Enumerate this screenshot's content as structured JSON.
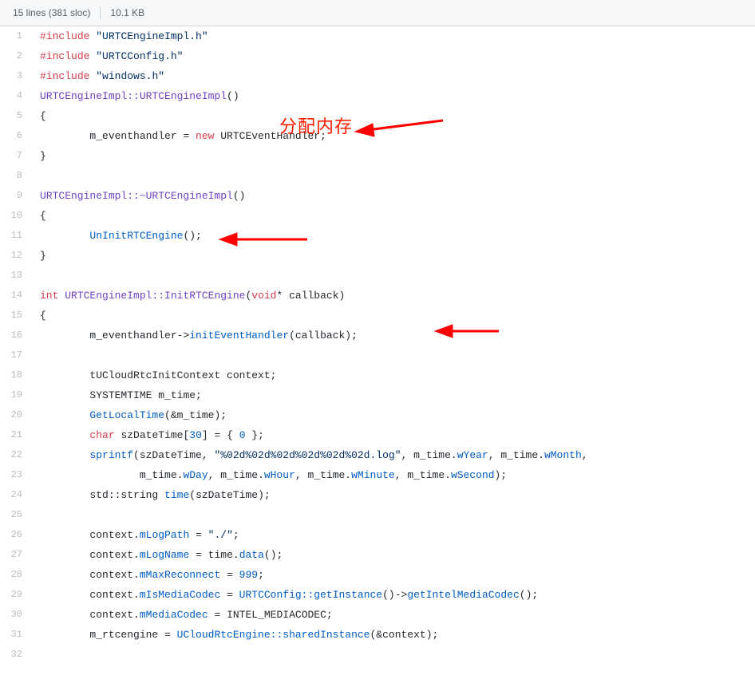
{
  "header": {
    "lines_label": "15 lines (381 sloc)",
    "size_label": "10.1 KB"
  },
  "annotations": {
    "alloc_text": "分配内存"
  },
  "code": [
    {
      "n": 1,
      "tokens": [
        {
          "t": "#",
          "c": "pl-k"
        },
        {
          "t": "include",
          "c": "pl-k"
        },
        {
          "t": " "
        },
        {
          "t": "\"URTCEngineImpl.h\"",
          "c": "pl-s"
        }
      ]
    },
    {
      "n": 2,
      "tokens": [
        {
          "t": "#",
          "c": "pl-k"
        },
        {
          "t": "include",
          "c": "pl-k"
        },
        {
          "t": " "
        },
        {
          "t": "\"URTCConfig.h\"",
          "c": "pl-s"
        }
      ]
    },
    {
      "n": 3,
      "tokens": [
        {
          "t": "#",
          "c": "pl-k"
        },
        {
          "t": "include",
          "c": "pl-k"
        },
        {
          "t": " "
        },
        {
          "t": "\"windows.h\"",
          "c": "pl-s"
        }
      ]
    },
    {
      "n": 4,
      "tokens": [
        {
          "t": "URTCEngineImpl::URTCEngineImpl",
          "c": "pl-en"
        },
        {
          "t": "()"
        }
      ]
    },
    {
      "n": 5,
      "tokens": [
        {
          "t": "{"
        }
      ]
    },
    {
      "n": 6,
      "tokens": [
        {
          "t": "\tm_eventhandler = "
        },
        {
          "t": "new",
          "c": "pl-k"
        },
        {
          "t": " URTCEventHandler;"
        }
      ]
    },
    {
      "n": 7,
      "tokens": [
        {
          "t": "}"
        }
      ]
    },
    {
      "n": 8,
      "tokens": []
    },
    {
      "n": 9,
      "tokens": [
        {
          "t": "URTCEngineImpl::~URTCEngineImpl",
          "c": "pl-en"
        },
        {
          "t": "()"
        }
      ]
    },
    {
      "n": 10,
      "tokens": [
        {
          "t": "{"
        }
      ]
    },
    {
      "n": 11,
      "tokens": [
        {
          "t": "\t"
        },
        {
          "t": "UnInitRTCEngine",
          "c": "pl-c1"
        },
        {
          "t": "();"
        }
      ]
    },
    {
      "n": 12,
      "tokens": [
        {
          "t": "}"
        }
      ]
    },
    {
      "n": 13,
      "tokens": []
    },
    {
      "n": 14,
      "tokens": [
        {
          "t": "int",
          "c": "pl-k"
        },
        {
          "t": " "
        },
        {
          "t": "URTCEngineImpl::InitRTCEngine",
          "c": "pl-en"
        },
        {
          "t": "("
        },
        {
          "t": "void",
          "c": "pl-k"
        },
        {
          "t": "* callback)"
        }
      ]
    },
    {
      "n": 15,
      "tokens": [
        {
          "t": "{"
        }
      ]
    },
    {
      "n": 16,
      "tokens": [
        {
          "t": "\tm_eventhandler->"
        },
        {
          "t": "initEventHandler",
          "c": "pl-c1"
        },
        {
          "t": "(callback);"
        }
      ]
    },
    {
      "n": 17,
      "tokens": []
    },
    {
      "n": 18,
      "tokens": [
        {
          "t": "\ttUCloudRtcInitContext context;"
        }
      ]
    },
    {
      "n": 19,
      "tokens": [
        {
          "t": "\tSYSTEMTIME m_time;"
        }
      ]
    },
    {
      "n": 20,
      "tokens": [
        {
          "t": "\t"
        },
        {
          "t": "GetLocalTime",
          "c": "pl-c1"
        },
        {
          "t": "(&m_time);"
        }
      ]
    },
    {
      "n": 21,
      "tokens": [
        {
          "t": "\t"
        },
        {
          "t": "char",
          "c": "pl-k"
        },
        {
          "t": " szDateTime["
        },
        {
          "t": "30",
          "c": "pl-c1"
        },
        {
          "t": "] = { "
        },
        {
          "t": "0",
          "c": "pl-c1"
        },
        {
          "t": " };"
        }
      ]
    },
    {
      "n": 22,
      "tokens": [
        {
          "t": "\t"
        },
        {
          "t": "sprintf",
          "c": "pl-c1"
        },
        {
          "t": "(szDateTime, "
        },
        {
          "t": "\"%02d%02d%02d%02d%02d%02d.log\"",
          "c": "pl-s"
        },
        {
          "t": ", m_time."
        },
        {
          "t": "wYear",
          "c": "pl-c1"
        },
        {
          "t": ", m_time."
        },
        {
          "t": "wMonth",
          "c": "pl-c1"
        },
        {
          "t": ","
        }
      ]
    },
    {
      "n": 23,
      "tokens": [
        {
          "t": "\t\tm_time."
        },
        {
          "t": "wDay",
          "c": "pl-c1"
        },
        {
          "t": ", m_time."
        },
        {
          "t": "wHour",
          "c": "pl-c1"
        },
        {
          "t": ", m_time."
        },
        {
          "t": "wMinute",
          "c": "pl-c1"
        },
        {
          "t": ", m_time."
        },
        {
          "t": "wSecond",
          "c": "pl-c1"
        },
        {
          "t": ");"
        }
      ]
    },
    {
      "n": 24,
      "tokens": [
        {
          "t": "\tstd::string "
        },
        {
          "t": "time",
          "c": "pl-c1"
        },
        {
          "t": "(szDateTime);"
        }
      ]
    },
    {
      "n": 25,
      "tokens": []
    },
    {
      "n": 26,
      "tokens": [
        {
          "t": "\tcontext."
        },
        {
          "t": "mLogPath",
          "c": "pl-c1"
        },
        {
          "t": " = "
        },
        {
          "t": "\"./\"",
          "c": "pl-s"
        },
        {
          "t": ";"
        }
      ]
    },
    {
      "n": 27,
      "tokens": [
        {
          "t": "\tcontext."
        },
        {
          "t": "mLogName",
          "c": "pl-c1"
        },
        {
          "t": " = time."
        },
        {
          "t": "data",
          "c": "pl-c1"
        },
        {
          "t": "();"
        }
      ]
    },
    {
      "n": 28,
      "tokens": [
        {
          "t": "\tcontext."
        },
        {
          "t": "mMaxReconnect",
          "c": "pl-c1"
        },
        {
          "t": " = "
        },
        {
          "t": "999",
          "c": "pl-c1"
        },
        {
          "t": ";"
        }
      ]
    },
    {
      "n": 29,
      "tokens": [
        {
          "t": "\tcontext."
        },
        {
          "t": "mIsMediaCodec",
          "c": "pl-c1"
        },
        {
          "t": " = "
        },
        {
          "t": "URTCConfig::getInstance",
          "c": "pl-c1"
        },
        {
          "t": "()->"
        },
        {
          "t": "getIntelMediaCodec",
          "c": "pl-c1"
        },
        {
          "t": "();"
        }
      ]
    },
    {
      "n": 30,
      "tokens": [
        {
          "t": "\tcontext."
        },
        {
          "t": "mMediaCodec",
          "c": "pl-c1"
        },
        {
          "t": " = INTEL_MEDIACODEC;"
        }
      ]
    },
    {
      "n": 31,
      "tokens": [
        {
          "t": "\tm_rtcengine = "
        },
        {
          "t": "UCloudRtcEngine::sharedInstance",
          "c": "pl-c1"
        },
        {
          "t": "(&context);"
        }
      ]
    },
    {
      "n": 32,
      "tokens": []
    }
  ]
}
